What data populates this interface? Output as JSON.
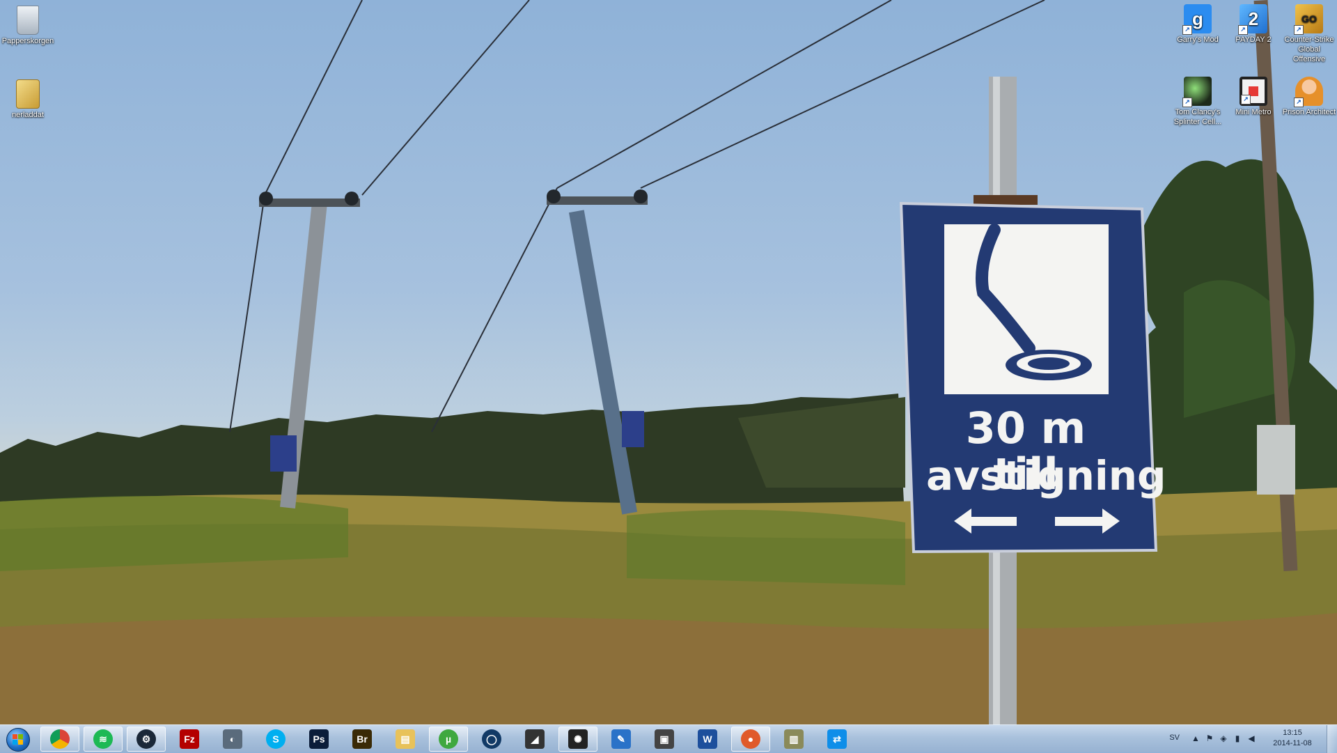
{
  "desktop": {
    "left_icons": [
      {
        "label": "Papperskorgen"
      },
      {
        "label": "nerladdat"
      }
    ],
    "right_icons": [
      {
        "label": "Garry's Mod",
        "glyph": "g",
        "color": "#2b8cf0"
      },
      {
        "label": "PAYDAY 2",
        "glyph": "2",
        "color": "#2a7fe0"
      },
      {
        "label": "Counter-Strike Global Offensive",
        "glyph": "GO",
        "color": "#d39a25"
      },
      {
        "label": "Tom Clancy's Splinter Cell...",
        "glyph": "",
        "color": "#2c3a2a"
      },
      {
        "label": "Mini Metro",
        "glyph": "",
        "color": "#f2f2f2"
      },
      {
        "label": "Prison Architect",
        "glyph": "",
        "color": "#e6a02a"
      }
    ],
    "sign": {
      "line1": "30 m till",
      "line2": "avstigning"
    }
  },
  "taskbar": {
    "start_label": "Start",
    "apps": [
      {
        "name": "chrome-icon",
        "glyph": "",
        "color": "#d33",
        "open": true
      },
      {
        "name": "spotify-icon",
        "glyph": "≋",
        "color": "#1db954",
        "open": true
      },
      {
        "name": "steam-icon",
        "glyph": "⚙",
        "color": "#1b2838",
        "open": true
      },
      {
        "name": "filezilla-icon",
        "glyph": "Fz",
        "color": "#b40000",
        "open": false
      },
      {
        "name": "teamspeak-icon",
        "glyph": "◐",
        "color": "#5a6b7c",
        "open": false
      },
      {
        "name": "skype-icon",
        "glyph": "S",
        "color": "#00aff0",
        "open": false
      },
      {
        "name": "photoshop-icon",
        "glyph": "Ps",
        "color": "#0b1d3a",
        "open": false
      },
      {
        "name": "bridge-icon",
        "glyph": "Br",
        "color": "#3a2a06",
        "open": false
      },
      {
        "name": "explorer-icon",
        "glyph": "▤",
        "color": "#e8c25a",
        "open": false
      },
      {
        "name": "utorrent-icon",
        "glyph": "µ",
        "color": "#3fa83f",
        "open": true
      },
      {
        "name": "origin-icon",
        "glyph": "◯",
        "color": "#123a66",
        "open": false
      },
      {
        "name": "speaker-app-icon",
        "glyph": "◢",
        "color": "#333",
        "open": false
      },
      {
        "name": "steelseries-icon",
        "glyph": "✺",
        "color": "#222",
        "open": true
      },
      {
        "name": "notepad-icon",
        "glyph": "✎",
        "color": "#2a72c8",
        "open": false
      },
      {
        "name": "movie-maker-icon",
        "glyph": "▣",
        "color": "#444",
        "open": false
      },
      {
        "name": "word-icon",
        "glyph": "W",
        "color": "#1d4f9c",
        "open": false
      },
      {
        "name": "wot-icon",
        "glyph": "●",
        "color": "#e05a2a",
        "open": true
      },
      {
        "name": "control-panel-icon",
        "glyph": "▥",
        "color": "#8a8a5a",
        "open": false
      },
      {
        "name": "teamviewer-icon",
        "glyph": "⇄",
        "color": "#0e8ee9",
        "open": false
      }
    ],
    "tray": {
      "language": "SV",
      "time": "13:15",
      "date": "2014-11-08"
    }
  }
}
